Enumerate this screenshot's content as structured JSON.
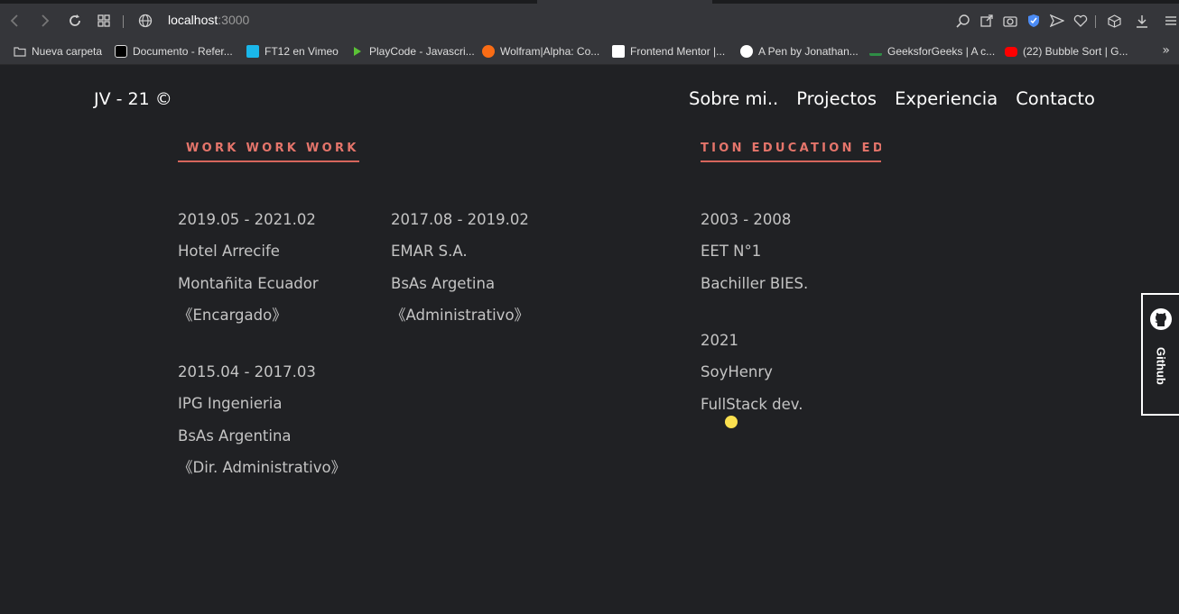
{
  "browser": {
    "url_host": "localhost",
    "url_port": ":3000",
    "bookmarks": [
      {
        "label": "Nueva carpeta",
        "icon": "folder-icon",
        "color": "#c9c9c9"
      },
      {
        "label": "Documento - Refer...",
        "icon": "mdn-icon",
        "color": "#ffffff"
      },
      {
        "label": "FT12 en Vimeo",
        "icon": "vimeo-icon",
        "color": "#1ab7ea"
      },
      {
        "label": "PlayCode - Javascri...",
        "icon": "playcode-icon",
        "color": "#5bc236"
      },
      {
        "label": "Wolfram|Alpha: Co...",
        "icon": "wolfram-icon",
        "color": "#f96c15"
      },
      {
        "label": "Frontend Mentor |...",
        "icon": "frontend-mentor-icon",
        "color": "#ffffff"
      },
      {
        "label": "A Pen by Jonathan...",
        "icon": "codepen-icon",
        "color": "#ffffff"
      },
      {
        "label": "GeeksforGeeks | A c...",
        "icon": "gfg-icon",
        "color": "#2f8d46"
      },
      {
        "label": "(22) Bubble Sort | G...",
        "icon": "youtube-icon",
        "color": "#ff0000"
      }
    ],
    "more_label": "»"
  },
  "header": {
    "brand": "JV - 21 ©",
    "nav": [
      "Sobre mi..",
      "Projectos",
      "Experiencia",
      "Contacto"
    ]
  },
  "work": {
    "title": "WORK WORK WORK",
    "entries": [
      {
        "dates": "2019.05 - 2021.02",
        "company": "Hotel Arrecife",
        "location": "Montañita Ecuador",
        "role": "《Encargado》"
      },
      {
        "dates": "2017.08 - 2019.02",
        "company": "EMAR S.A.",
        "location": "BsAs Argetina",
        "role": "《Administrativo》"
      },
      {
        "dates": "2015.04 - 2017.03",
        "company": "IPG Ingenieria",
        "location": "BsAs Argentina",
        "role": "《Dir. Administrativo》"
      }
    ]
  },
  "education": {
    "title": "TION EDUCATION ED",
    "entries": [
      {
        "dates": "2003 - 2008",
        "school": "EET N°1",
        "degree": "Bachiller BIES."
      },
      {
        "dates": "2021",
        "school": "SoyHenry",
        "degree": "FullStack dev."
      }
    ]
  },
  "social": {
    "label": "Github",
    "icon": "github-icon"
  },
  "colors": {
    "accent": "#e5756b",
    "background": "#202124",
    "dot": "#fbe04f"
  }
}
